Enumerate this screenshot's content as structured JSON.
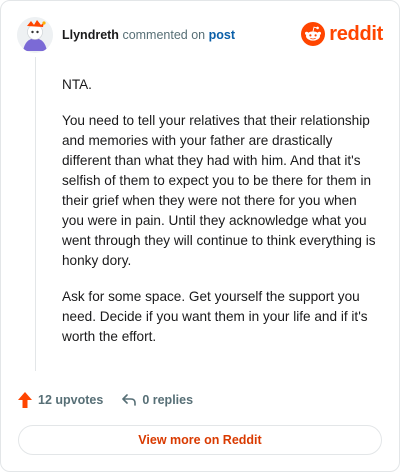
{
  "header": {
    "username": "Llyndreth",
    "action_text": "commented on",
    "post_link": "post",
    "logo_text": "reddit"
  },
  "comment": {
    "paragraphs": [
      "NTA.",
      "You need to tell your relatives that their relationship and memories with your father are drastically different than what they had with him. And that it's selfish of them to expect you to be there for them in their grief when they were not there for you when you were in pain. Until they acknowledge what you went through they will continue to think everything is honky dory.",
      "Ask for some space. Get yourself the support you need. Decide if you want them in your life and if it's worth the effort."
    ]
  },
  "actions": {
    "upvotes": "12 upvotes",
    "replies": "0 replies"
  },
  "footer": {
    "view_more": "View more on Reddit"
  },
  "colors": {
    "brand": "#ff4500",
    "link": "#0a5fa8",
    "muted": "#576f76",
    "view_more": "#d93a00"
  }
}
